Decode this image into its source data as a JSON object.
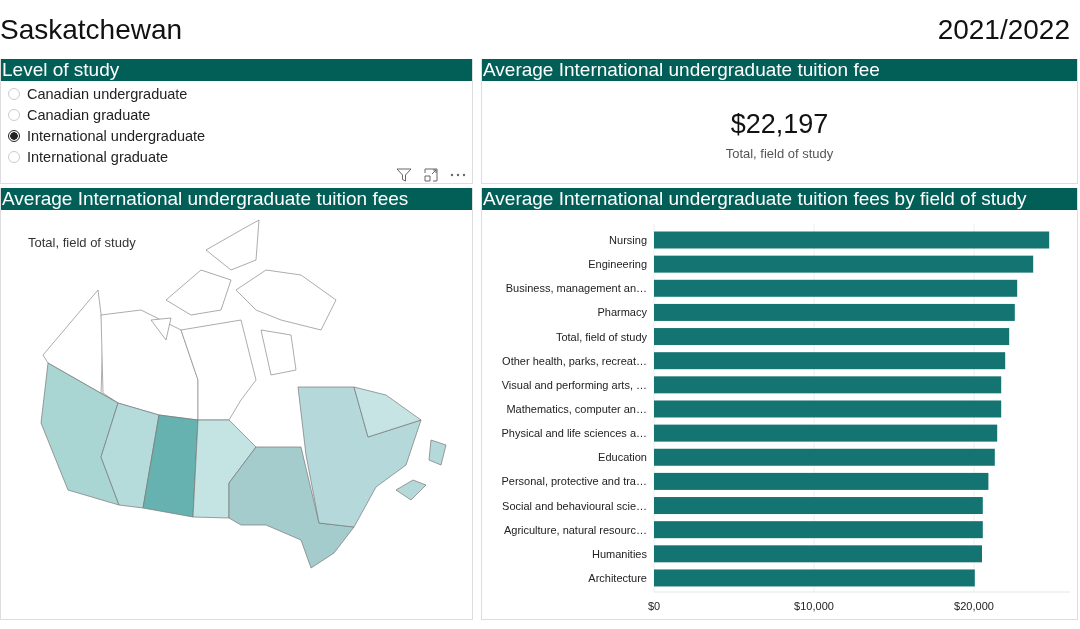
{
  "header": {
    "title": "Saskatchewan",
    "year": "2021/2022"
  },
  "level_panel": {
    "title": "Level of study",
    "options": [
      {
        "label": "Canadian undergraduate",
        "selected": false
      },
      {
        "label": "Canadian graduate",
        "selected": false
      },
      {
        "label": "International undergraduate",
        "selected": true
      },
      {
        "label": "International graduate",
        "selected": false
      }
    ]
  },
  "summary_card": {
    "title": "Average International undergraduate tuition fee",
    "value": "$22,197",
    "label": "Total, field of study"
  },
  "map_panel": {
    "title": "Average International undergraduate tuition fees",
    "caption": "Total, field of study"
  },
  "chart_panel": {
    "title": "Average International undergraduate tuition fees by field of study",
    "chart_data": {
      "type": "bar",
      "orientation": "horizontal",
      "categories": [
        "Nursing",
        "Engineering",
        "Business, management an…",
        "Pharmacy",
        "Total, field of study",
        "Other health, parks, recreat…",
        "Visual and performing arts, …",
        "Mathematics, computer an…",
        "Physical and life sciences a…",
        "Education",
        "Personal, protective and tra…",
        "Social and behavioural scie…",
        "Agriculture, natural resourc…",
        "Humanities",
        "Architecture"
      ],
      "values": [
        24700,
        23700,
        22700,
        22550,
        22200,
        21950,
        21700,
        21700,
        21450,
        21300,
        20900,
        20550,
        20550,
        20500,
        20050
      ],
      "xlim": [
        0,
        26000
      ],
      "xticks": [
        {
          "value": 0,
          "label": "$0"
        },
        {
          "value": 10000,
          "label": "$10,000"
        },
        {
          "value": 20000,
          "label": "$20,000"
        }
      ]
    }
  }
}
